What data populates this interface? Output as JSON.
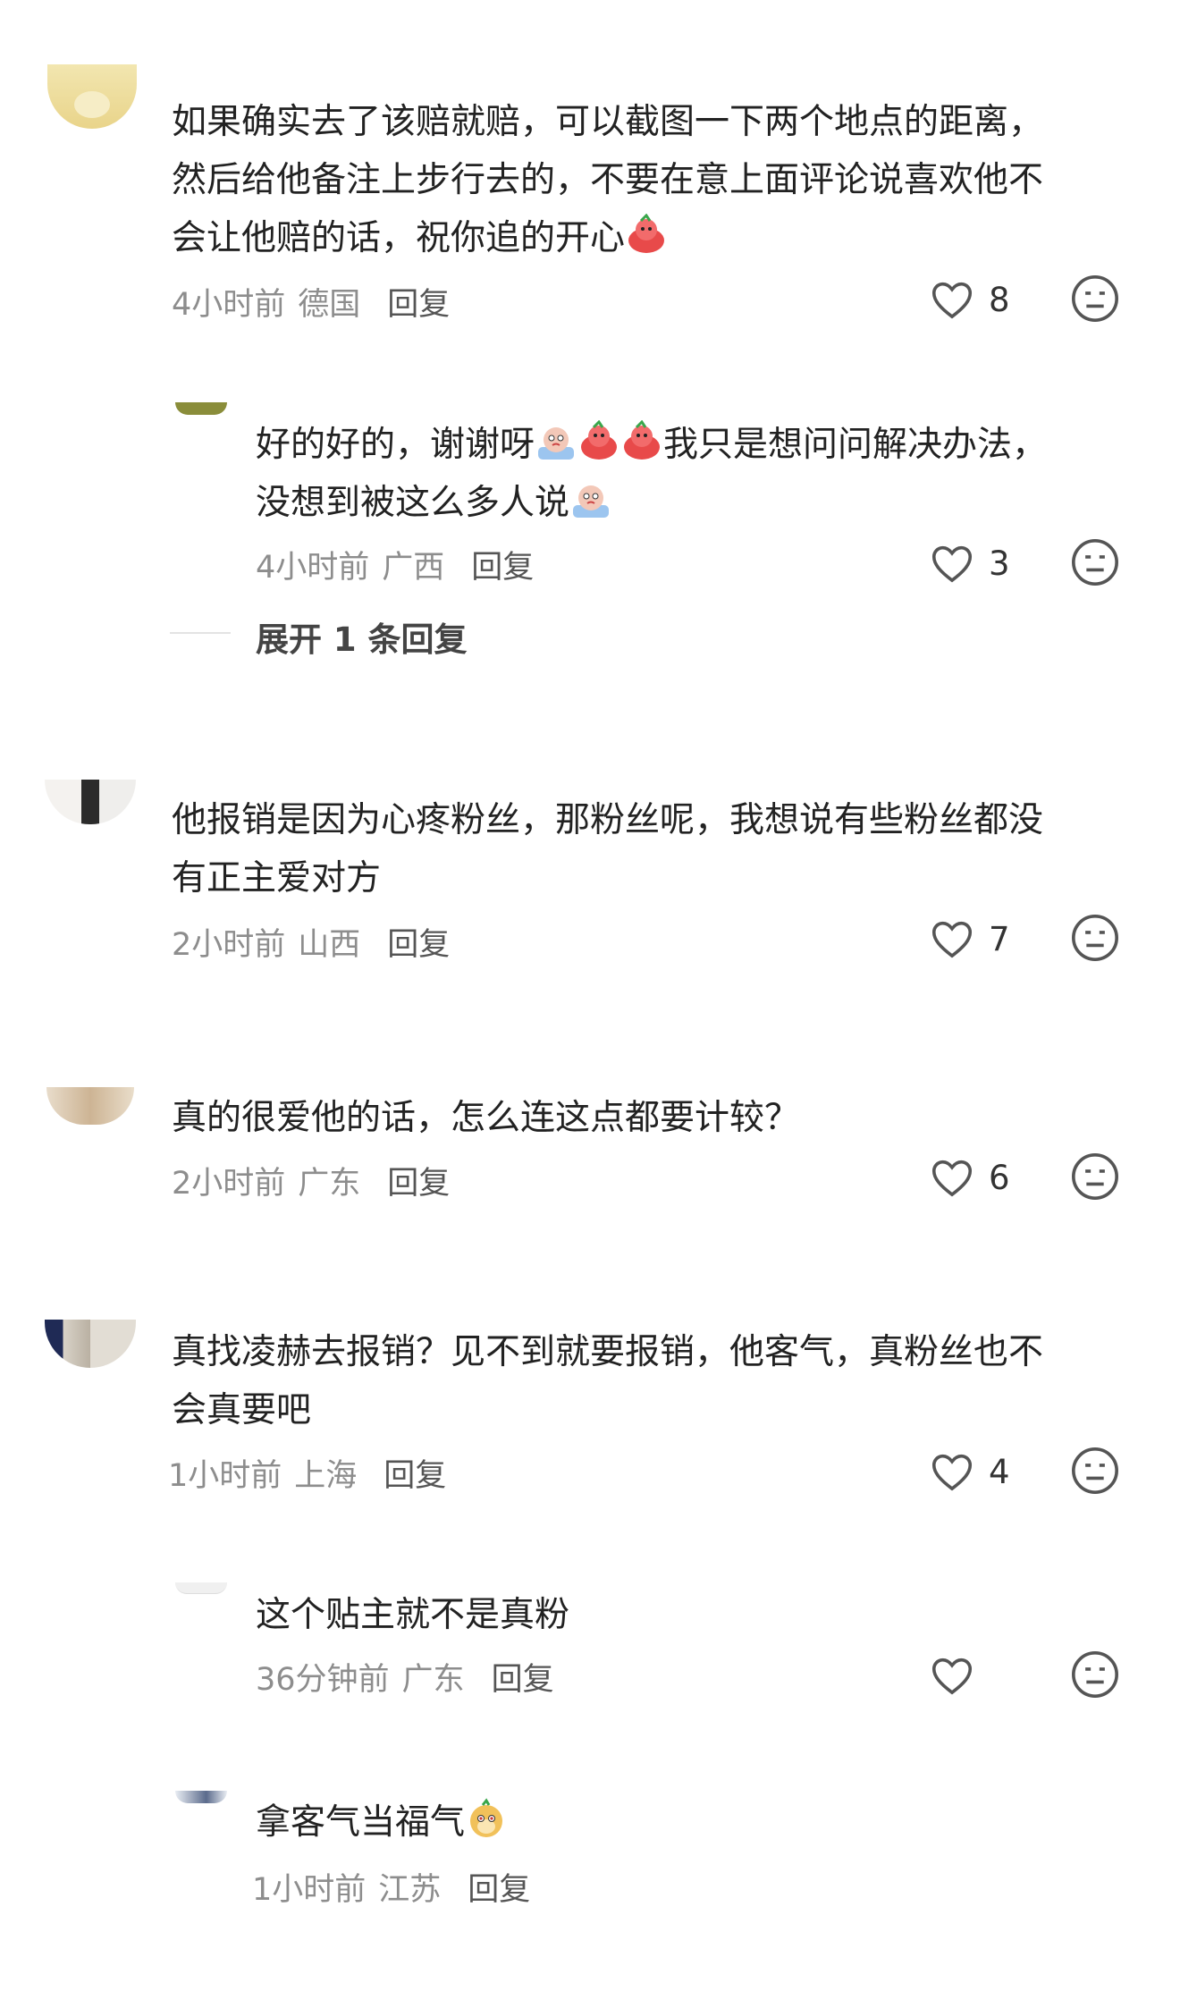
{
  "comments": [
    {
      "lines": [
        "如果确实去了该赔就赔，可以截图一下两个地点的距离，",
        "然后给他备注上步行去的，不要在意上面评论说喜欢他不",
        "会让他赔的话，祝你追的开心"
      ],
      "time": "4小时前",
      "location": "德国",
      "reply": "回复",
      "likes": "8"
    },
    {
      "lines": [
        "好的好的，谢谢呀",
        "我只是想问问解决办法，",
        "没想到被这么多人说"
      ],
      "time": "4小时前",
      "location": "广西",
      "reply": "回复",
      "likes": "3",
      "expand": "展开 1 条回复"
    },
    {
      "lines": [
        "他报销是因为心疼粉丝，那粉丝呢，我想说有些粉丝都没",
        "有正主爱对方"
      ],
      "time": "2小时前",
      "location": "山西",
      "reply": "回复",
      "likes": "7"
    },
    {
      "lines": [
        "真的很爱他的话，怎么连这点都要计较？"
      ],
      "time": "2小时前",
      "location": "广东",
      "reply": "回复",
      "likes": "6"
    },
    {
      "lines": [
        "真找凌赫去报销？见不到就要报销，他客气，真粉丝也不",
        "会真要吧"
      ],
      "time": "1小时前",
      "location": "上海",
      "reply": "回复",
      "likes": "4"
    },
    {
      "lines": [
        "这个贴主就不是真粉"
      ],
      "time": "36分钟前",
      "location": "广东",
      "reply": "回复",
      "likes": ""
    },
    {
      "lines": [
        "拿客气当福气"
      ],
      "time": "1小时前",
      "location": "江苏",
      "reply": "回复"
    }
  ],
  "icons": {
    "like": "heart-outline-icon",
    "dislike": "neutral-face-icon"
  }
}
